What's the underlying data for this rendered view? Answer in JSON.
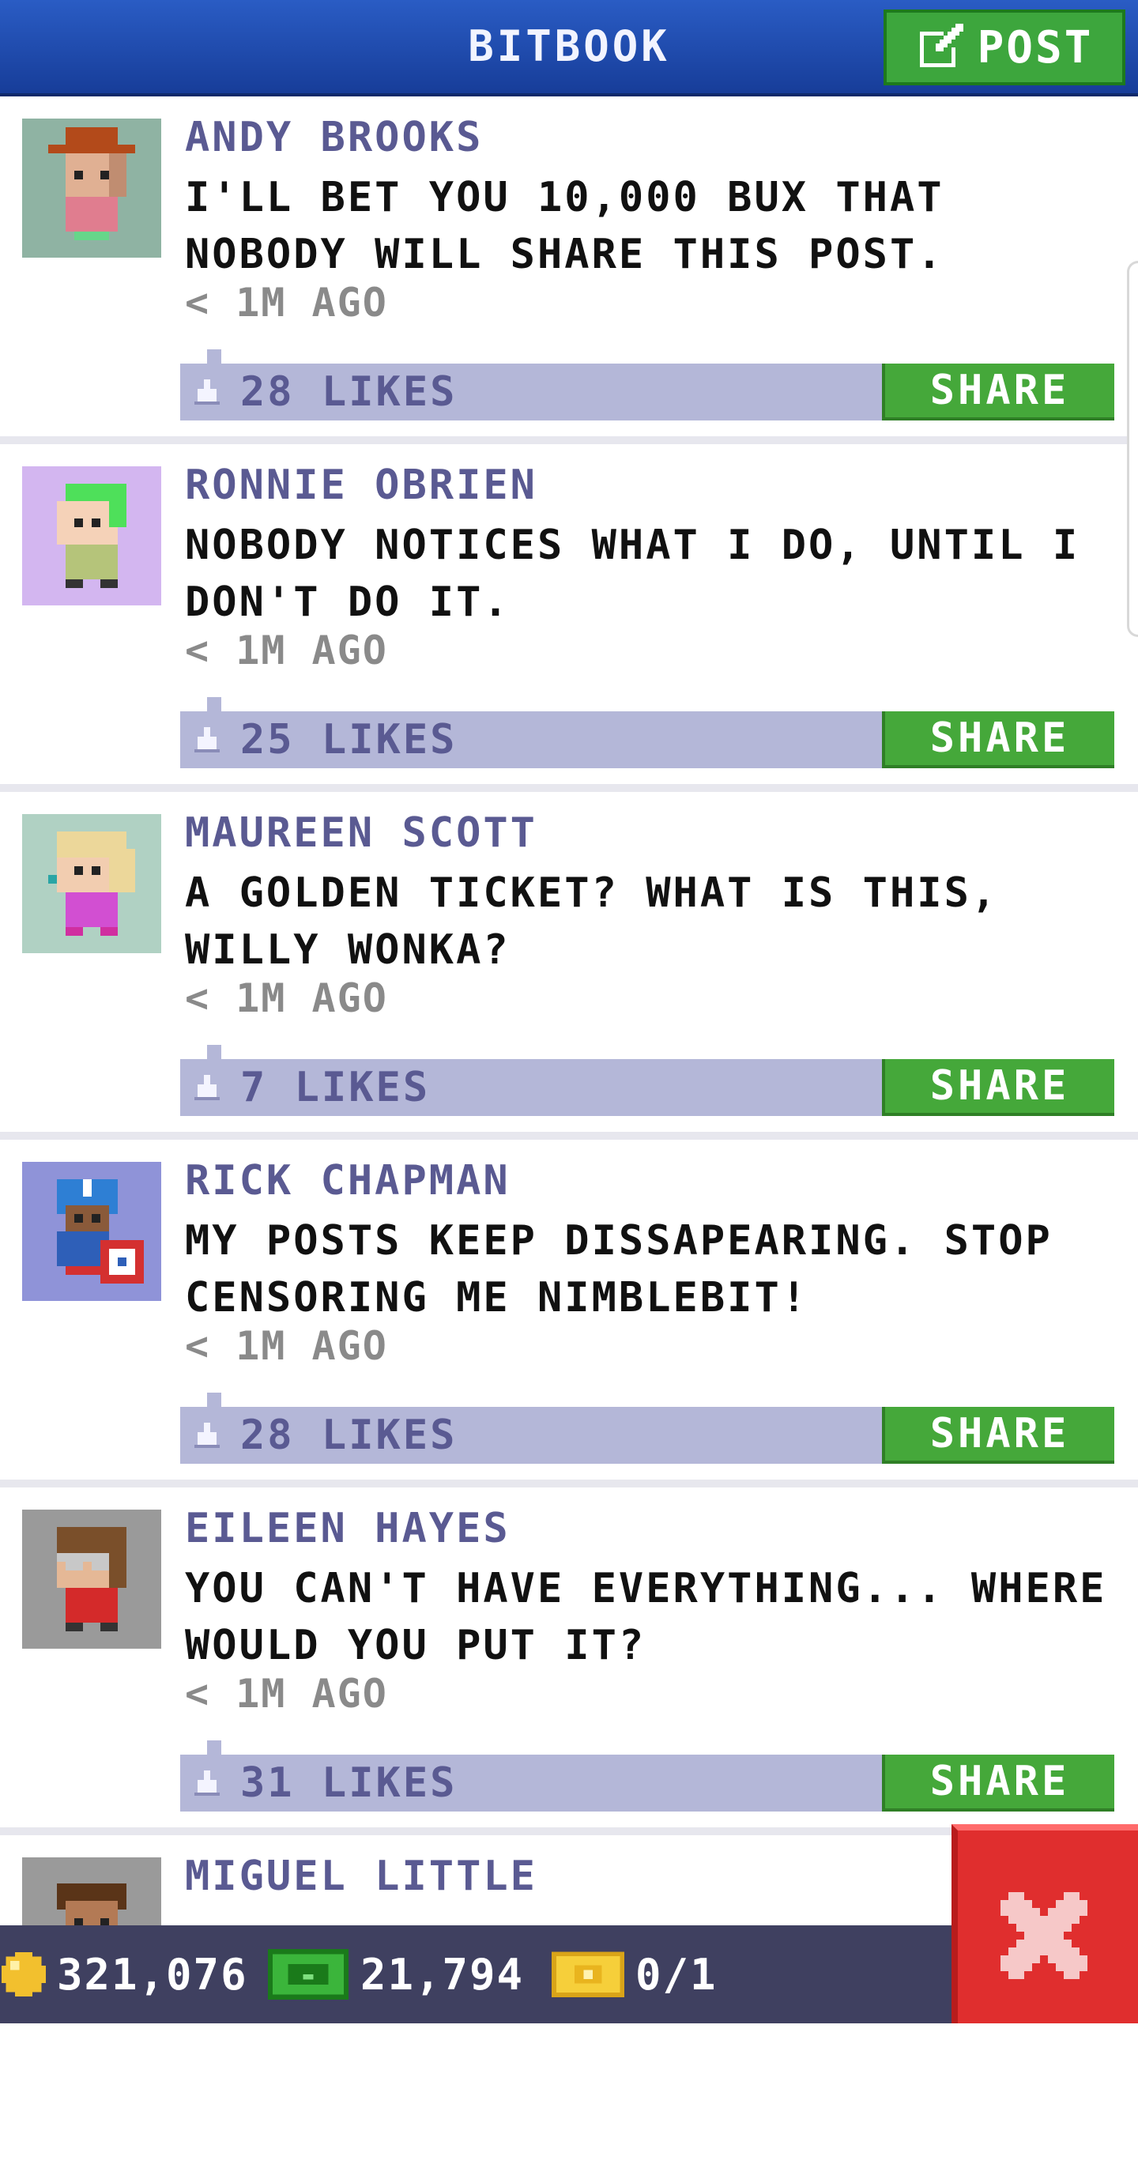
{
  "header": {
    "title": "BITBOOK",
    "post_label": "POST"
  },
  "posts": [
    {
      "name": "ANDY BROOKS",
      "text": "I'LL BET YOU 10,000 BUX THAT NOBODY WILL SHARE THIS POST.",
      "time": "< 1M AGO",
      "likes": "28 LIKES",
      "share": "SHARE"
    },
    {
      "name": "RONNIE OBRIEN",
      "text": "NOBODY NOTICES WHAT I DO, UNTIL I DON'T DO IT.",
      "time": "< 1M AGO",
      "likes": "25 LIKES",
      "share": "SHARE"
    },
    {
      "name": "MAUREEN SCOTT",
      "text": "A GOLDEN TICKET? WHAT IS THIS, WILLY WONKA?",
      "time": "< 1M AGO",
      "likes": "7 LIKES",
      "share": "SHARE"
    },
    {
      "name": "RICK CHAPMAN",
      "text": "MY POSTS KEEP DISSAPEARING. STOP CENSORING ME NIMBLEBIT!",
      "time": "< 1M AGO",
      "likes": "28 LIKES",
      "share": "SHARE"
    },
    {
      "name": "EILEEN HAYES",
      "text": "YOU CAN'T HAVE EVERYTHING... WHERE WOULD YOU PUT IT?",
      "time": "< 1M AGO",
      "likes": "31 LIKES",
      "share": "SHARE"
    },
    {
      "name": "MIGUEL LITTLE"
    }
  ],
  "status": {
    "coins": "321,076",
    "bux": "21,794",
    "tickets": "0/1"
  },
  "colors": {
    "header": "#1f4db3",
    "accent_green": "#45a83a",
    "likes_bar": "#b4b7d8",
    "name_text": "#5a5a92",
    "close_red": "#e02e2e",
    "bottom_bar": "#3f4060"
  },
  "icons": {
    "post": "edit-icon",
    "like": "thumbs-up-icon",
    "coins": "coin-icon",
    "bux": "bux-icon",
    "tickets": "golden-ticket-icon",
    "close": "close-icon"
  }
}
